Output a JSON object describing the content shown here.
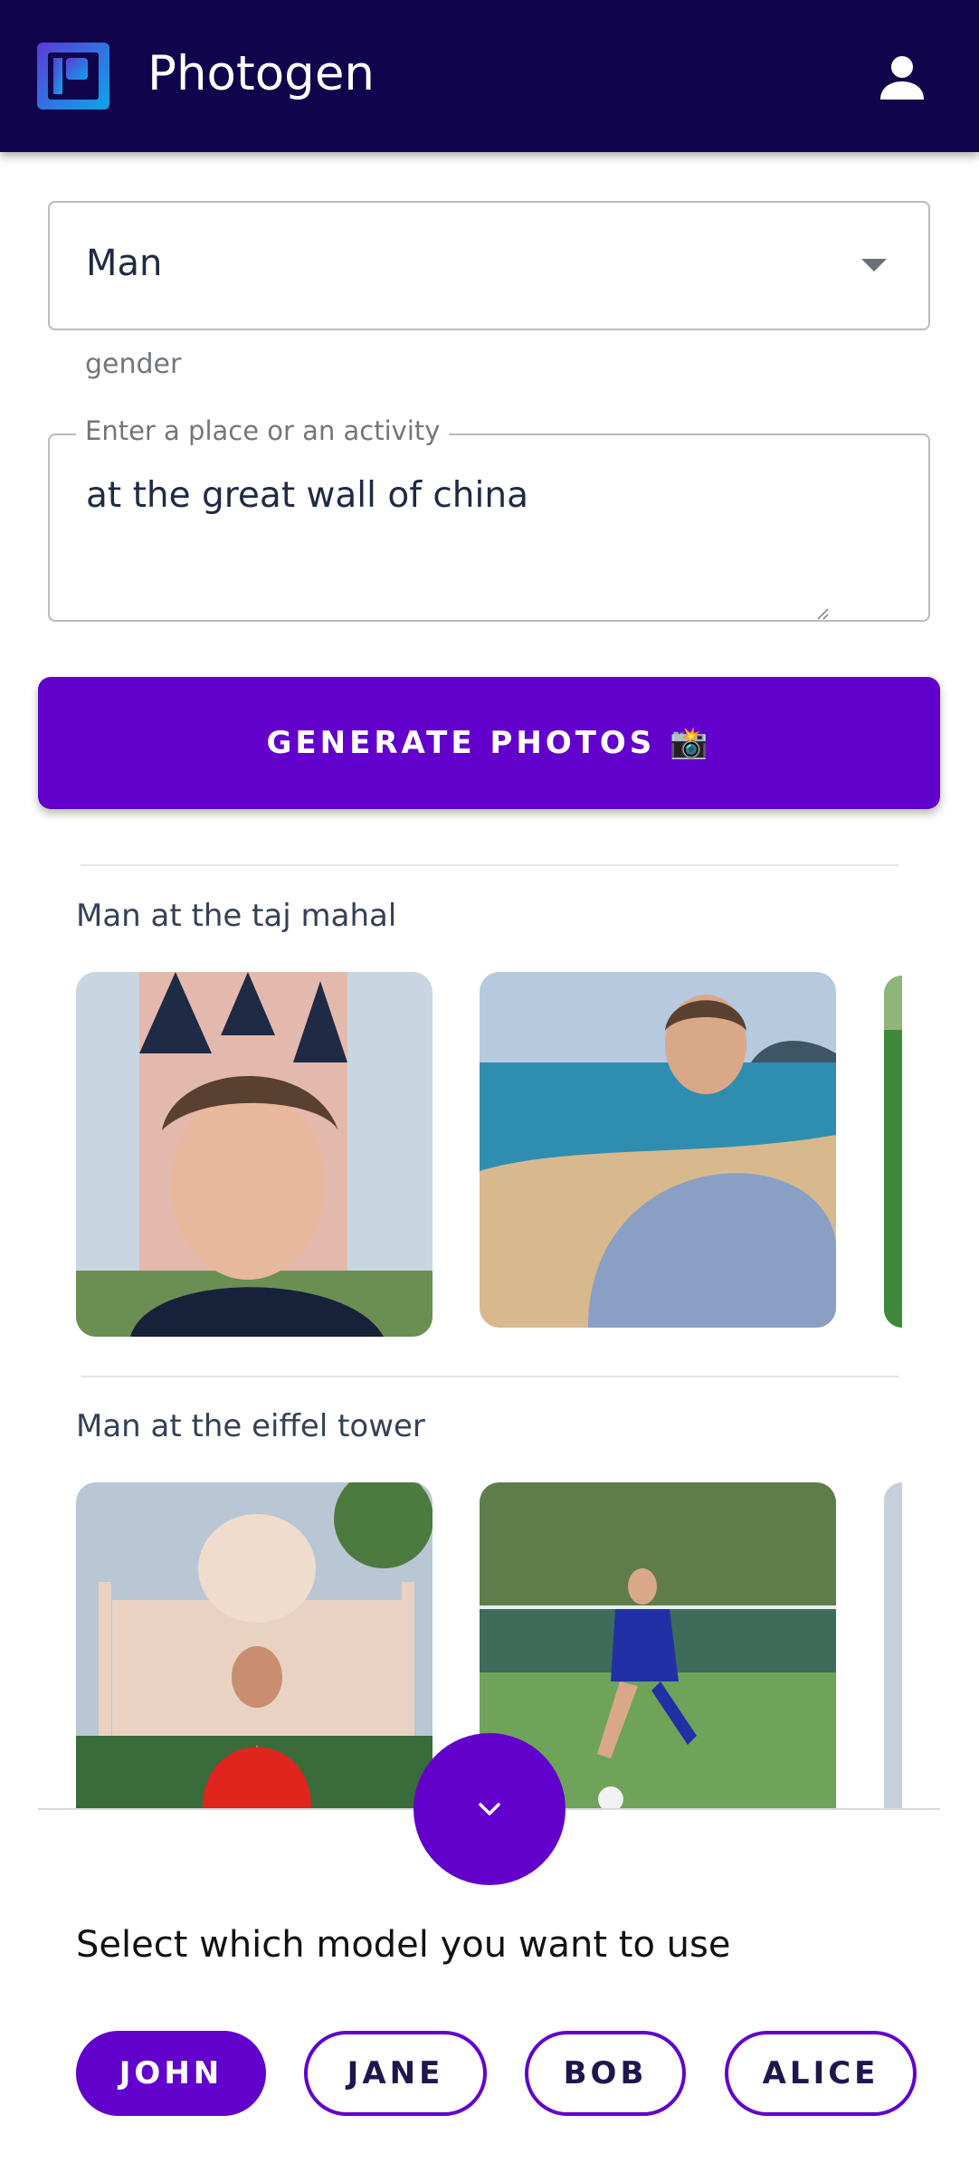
{
  "app": {
    "title": "Photogen",
    "logo_icon": "photogen-logo-icon",
    "account_icon": "account-icon"
  },
  "form": {
    "gender": {
      "value": "Man",
      "helper": "gender"
    },
    "activity": {
      "label": "Enter a place or an activity",
      "value": "at the great wall of china"
    },
    "generate_button": "GENERATE PHOTOS 📸"
  },
  "gallery": {
    "sections": [
      {
        "title": "Man at the taj mahal",
        "photos": [
          "photo-castle-portrait",
          "photo-beach-portrait",
          "photo-partial-green"
        ]
      },
      {
        "title": "Man at the eiffel tower",
        "photos": [
          "photo-taj-mahal-portrait",
          "photo-soccer-field",
          "photo-partial-grey"
        ]
      }
    ]
  },
  "drawer": {
    "toggle_icon": "chevron-down-icon",
    "prompt": "Select which model you want to use",
    "models": [
      "JOHN",
      "JANE",
      "BOB",
      "ALICE"
    ],
    "selected_model": "JOHN"
  },
  "colors": {
    "appbar": "#10054d",
    "accent": "#6200cc"
  }
}
